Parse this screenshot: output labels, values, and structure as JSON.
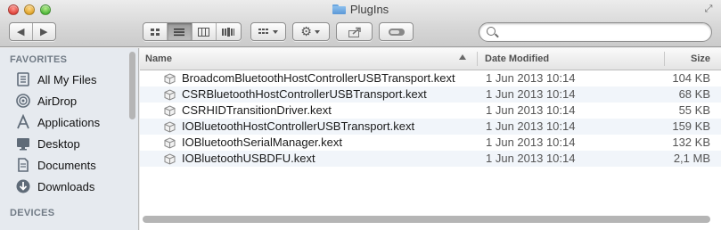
{
  "window": {
    "title": "PlugIns"
  },
  "toolbar": {
    "nav": [
      "◀",
      "▶"
    ],
    "views": [
      "icon-view",
      "list-view",
      "column-view",
      "coverflow-view"
    ],
    "search_placeholder": ""
  },
  "sidebar": {
    "favorites_header": "FAVORITES",
    "devices_header": "DEVICES",
    "items": [
      {
        "label": "All My Files",
        "icon": "all-files-icon"
      },
      {
        "label": "AirDrop",
        "icon": "airdrop-icon"
      },
      {
        "label": "Applications",
        "icon": "applications-icon"
      },
      {
        "label": "Desktop",
        "icon": "desktop-icon"
      },
      {
        "label": "Documents",
        "icon": "documents-icon"
      },
      {
        "label": "Downloads",
        "icon": "downloads-icon"
      }
    ]
  },
  "columns": {
    "name": "Name",
    "date": "Date Modified",
    "size": "Size"
  },
  "files": [
    {
      "name": "BroadcomBluetoothHostControllerUSBTransport.kext",
      "date": "1 Jun 2013 10:14",
      "size": "104 KB"
    },
    {
      "name": "CSRBluetoothHostControllerUSBTransport.kext",
      "date": "1 Jun 2013 10:14",
      "size": "68 KB"
    },
    {
      "name": "CSRHIDTransitionDriver.kext",
      "date": "1 Jun 2013 10:14",
      "size": "55 KB"
    },
    {
      "name": "IOBluetoothHostControllerUSBTransport.kext",
      "date": "1 Jun 2013 10:14",
      "size": "159 KB"
    },
    {
      "name": "IOBluetoothSerialManager.kext",
      "date": "1 Jun 2013 10:14",
      "size": "132 KB"
    },
    {
      "name": "IOBluetoothUSBDFU.kext",
      "date": "1 Jun 2013 10:14",
      "size": "2,1 MB"
    }
  ]
}
